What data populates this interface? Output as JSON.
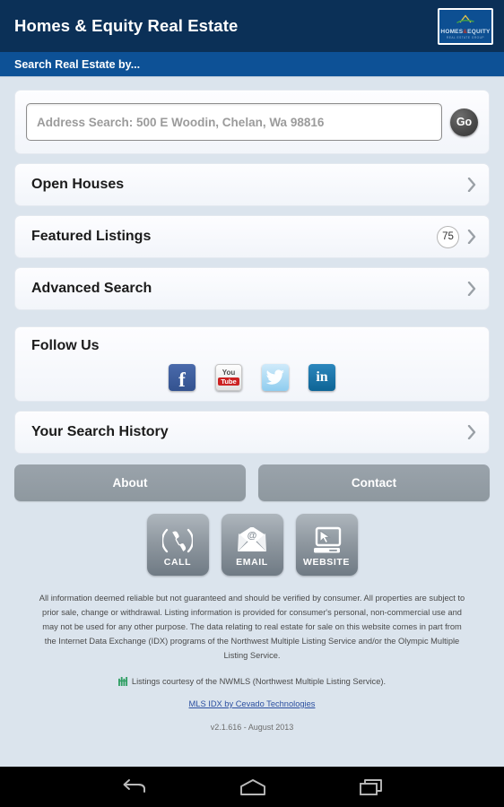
{
  "header": {
    "title": "Homes & Equity Real Estate",
    "logo": {
      "wordmark_left": "HOMES",
      "wordmark_amp": "&",
      "wordmark_right": "EQUITY",
      "tagline": "REAL ESTATE GROUP"
    },
    "subbar": "Search Real Estate by..."
  },
  "search": {
    "placeholder": "Address Search: 500 E Woodin, Chelan, Wa 98816",
    "value": "",
    "go_label": "Go"
  },
  "nav_rows": [
    {
      "label": "Open Houses",
      "badge": ""
    },
    {
      "label": "Featured Listings",
      "badge": "75"
    },
    {
      "label": "Advanced Search",
      "badge": ""
    }
  ],
  "follow": {
    "title": "Follow Us",
    "socials": [
      {
        "name": "facebook",
        "glyph": "f"
      },
      {
        "name": "youtube",
        "top": "You",
        "bottom": "Tube"
      },
      {
        "name": "twitter",
        "glyph": "bird"
      },
      {
        "name": "linkedin",
        "glyph": "in"
      }
    ]
  },
  "history": {
    "label": "Your Search History"
  },
  "buttons": {
    "about": "About",
    "contact": "Contact"
  },
  "tiles": [
    {
      "label": "CALL",
      "icon": "phone-icon"
    },
    {
      "label": "EMAIL",
      "icon": "envelope-icon"
    },
    {
      "label": "WEBSITE",
      "icon": "monitor-icon"
    }
  ],
  "footer": {
    "disclaimer": "All information deemed reliable but not guaranteed and should be verified by consumer. All properties are subject to prior sale, change or withdrawal. Listing information is provided for consumer's personal, non-commercial use and may not be used for any other purpose. The data relating to real estate for sale on this website comes in part from the Internet Data Exchange (IDX) programs of the Northwest Multiple Listing Service and/or the Olympic Multiple Listing Service.",
    "mls_line": "Listings courtesy of the NWMLS (Northwest Multiple Listing Service).",
    "idx_link": "MLS IDX by Cevado Technologies",
    "version": "v2.1.616 - August 2013"
  },
  "colors": {
    "appbar": "#0b3057",
    "subbar": "#0d5196",
    "page_bg": "#dbe4ed",
    "card_bg": "#f7f9fc",
    "button_gray": "#939da6",
    "link": "#2b4fa0"
  },
  "android_nav": [
    {
      "name": "back-icon"
    },
    {
      "name": "home-icon"
    },
    {
      "name": "recents-icon"
    }
  ]
}
